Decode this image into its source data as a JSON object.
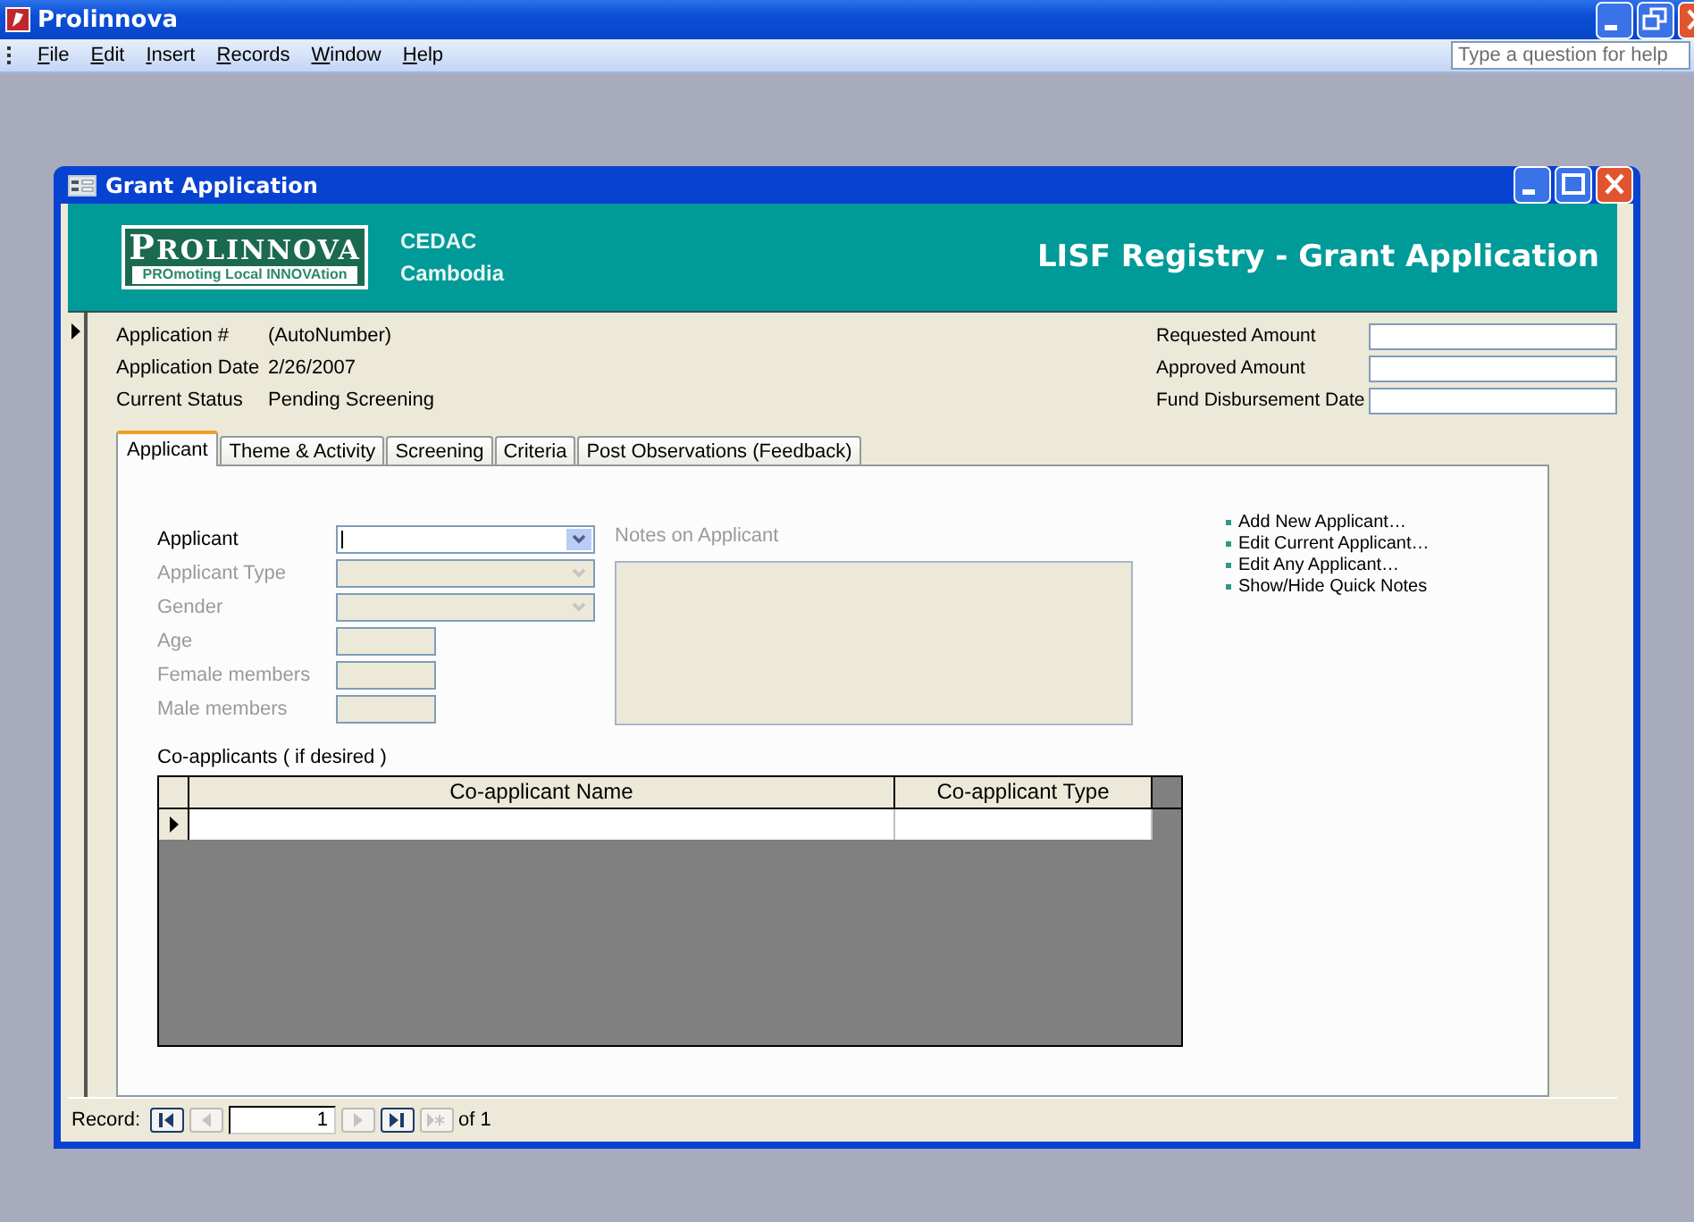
{
  "app": {
    "title": "Prolinnova",
    "menu": [
      "File",
      "Edit",
      "Insert",
      "Records",
      "Window",
      "Help"
    ],
    "help": {
      "placeholder": "Type a question for help"
    }
  },
  "form": {
    "title": "Grant Application",
    "logo": {
      "name": "PROLINNOVA",
      "tagline": "PROmoting Local INNOVAtion"
    },
    "org": [
      "CEDAC",
      "Cambodia"
    ],
    "heading": "LISF Registry - Grant Application",
    "info": [
      {
        "label": "Application #",
        "value": "(AutoNumber)"
      },
      {
        "label": "Application Date",
        "value": "2/26/2007"
      },
      {
        "label": "Current Status",
        "value": "Pending Screening"
      }
    ],
    "amounts": [
      {
        "label": "Requested Amount"
      },
      {
        "label": "Approved Amount"
      },
      {
        "label": "Fund Disbursement Date"
      }
    ],
    "tabs": [
      {
        "label": "Applicant",
        "selected": true
      },
      {
        "label": "Theme & Activity",
        "selected": false
      },
      {
        "label": "Screening",
        "selected": false
      },
      {
        "label": "Criteria",
        "selected": false
      },
      {
        "label": "Post Observations (Feedback)",
        "selected": false
      }
    ],
    "fields": [
      {
        "label": "Applicant",
        "kind": "combo",
        "disabled": false
      },
      {
        "label": "Applicant Type",
        "kind": "combo",
        "disabled": true
      },
      {
        "label": "Gender",
        "kind": "combo",
        "disabled": true
      },
      {
        "label": "Age",
        "kind": "text",
        "disabled": true
      },
      {
        "label": "Female members",
        "kind": "text",
        "disabled": true
      },
      {
        "label": "Male members",
        "kind": "text",
        "disabled": true
      }
    ],
    "notes": {
      "label": "Notes on Applicant",
      "disabled": true
    },
    "links": [
      "Add New Applicant…",
      "Edit Current Applicant…",
      "Edit Any Applicant…",
      "Show/Hide Quick Notes"
    ],
    "coapplicants": {
      "label": "Co-applicants ( if desired )",
      "columns": [
        "Co-applicant Name",
        "Co-applicant Type"
      ]
    },
    "navigation": {
      "label": "Record:",
      "current": "1",
      "total": "of 1",
      "buttons": [
        {
          "kind": "first",
          "disabled": false
        },
        {
          "kind": "prev",
          "disabled": true
        },
        {
          "kind": "next",
          "disabled": true
        },
        {
          "kind": "last",
          "disabled": false
        },
        {
          "kind": "new",
          "disabled": true
        }
      ]
    }
  }
}
